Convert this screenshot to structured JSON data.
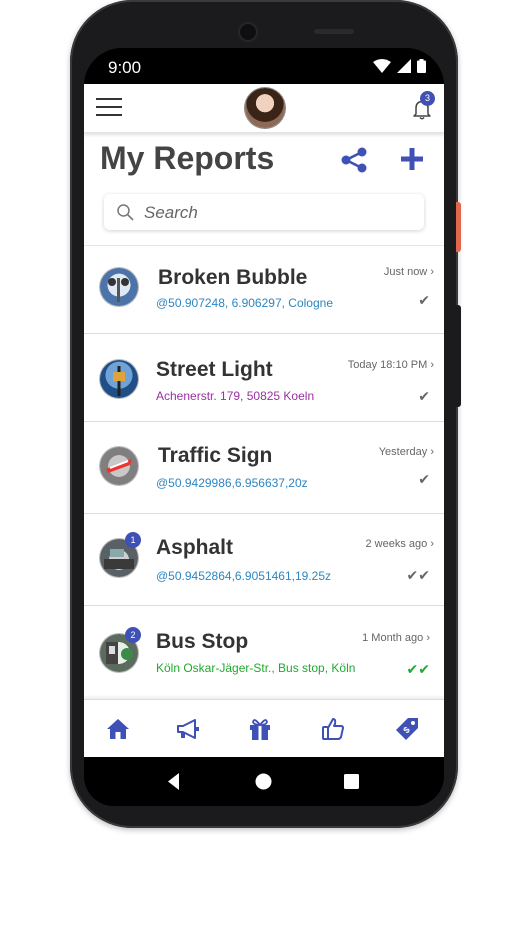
{
  "status": {
    "time": "9:00"
  },
  "header": {
    "notification_count": "3"
  },
  "page": {
    "title": "My Reports"
  },
  "search": {
    "placeholder": "Search"
  },
  "reports": [
    {
      "title": "Broken Bubble",
      "location": "@50.907248, 6.906297, Cologne",
      "time": "Just now",
      "check": "✔",
      "badge": ""
    },
    {
      "title": "Street Light",
      "location": "Achenerstr. 179, 50825 Koeln",
      "time": "Today 18:10 PM",
      "check": "✔",
      "badge": ""
    },
    {
      "title": "Traffic Sign",
      "location": "@50.9429986,6.956637,20z",
      "time": "Yesterday",
      "check": "✔",
      "badge": ""
    },
    {
      "title": "Asphalt",
      "location": "@50.9452864,6.9051461,19.25z",
      "time": "2 weeks ago",
      "check": "✔✔",
      "badge": "1"
    },
    {
      "title": "Bus Stop",
      "location": "Köln Oskar-Jäger-Str., Bus stop, Köln",
      "time": "1 Month ago",
      "check": "✔✔",
      "badge": "2"
    }
  ],
  "colors": {
    "accent": "#3f51b5",
    "link_blue": "#2e86c1",
    "purple": "#9b2fa0",
    "green": "#1faa2e",
    "gray_check": "#666666"
  },
  "icons": [
    "home-icon",
    "megaphone-icon",
    "gift-icon",
    "thumbs-up-icon",
    "tag-icon"
  ]
}
